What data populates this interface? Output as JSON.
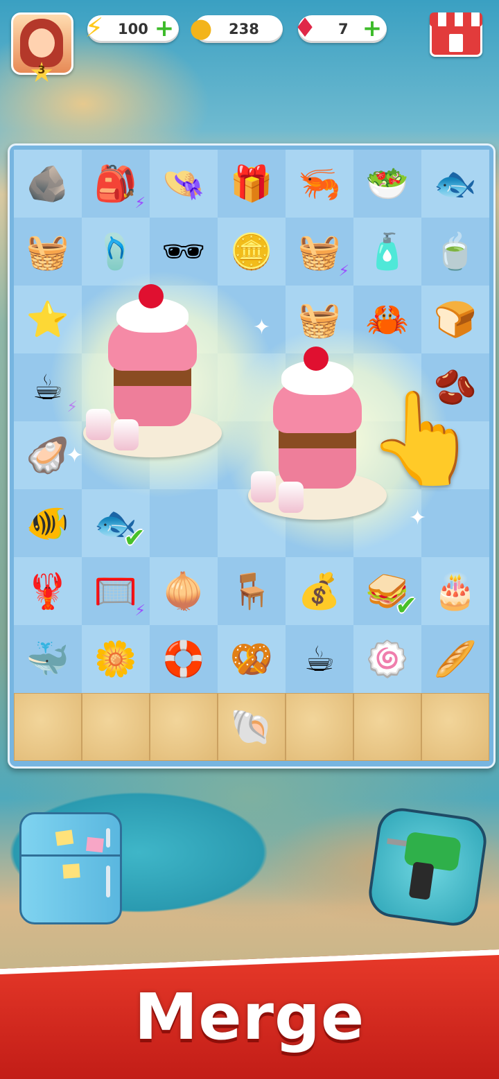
{
  "hud": {
    "level": "3",
    "energy": {
      "value": "100",
      "icon": "lightning-icon"
    },
    "coins": {
      "value": "238",
      "icon": "coin-icon"
    },
    "gems": {
      "value": "7",
      "icon": "ruby-gem-icon"
    },
    "shop_icon": "shop-stall-icon"
  },
  "board": {
    "columns": 7,
    "rows": [
      [
        "seaweed-rocks",
        "beach-bag",
        "straw-hat",
        "gift-box-fish",
        "shrimp-clam",
        "shrimp-salad",
        "fishing-lure"
      ],
      [
        "shell-basket",
        "flip-flops",
        "sunglasses",
        "coin",
        "picnic-basket",
        "sunscreen",
        "iced-tea"
      ],
      [
        "starfish",
        "",
        "",
        "",
        "laundry-basket",
        "crab-plate",
        "toast"
      ],
      [
        "coffee-machine",
        "",
        "",
        "",
        "",
        "",
        "coffee-beans"
      ],
      [
        "oyster-plate",
        "",
        "",
        "",
        "",
        "",
        ""
      ],
      [
        "fish-tank",
        "fish",
        "",
        "",
        "",
        "",
        ""
      ],
      [
        "lobster-plate",
        "fishing-net",
        "onion",
        "beach-chair",
        "coin-pile",
        "sandwich",
        "layer-cake"
      ],
      [
        "fish-toy-starfish",
        "flower-pot",
        "swim-ring",
        "pretzel-box",
        "coffee-cup",
        "swiss-roll",
        "bread-loaf"
      ],
      [
        "sand",
        "sand",
        "sand",
        "seashell",
        "sand",
        "sand",
        "sand"
      ]
    ],
    "merge_item": "ice-cream-sundae",
    "hint": "pointing-hand"
  },
  "tools": {
    "left": "fridge",
    "right": "power-drill"
  },
  "banner": {
    "title": "Merge",
    "color": "#e83a2a"
  }
}
